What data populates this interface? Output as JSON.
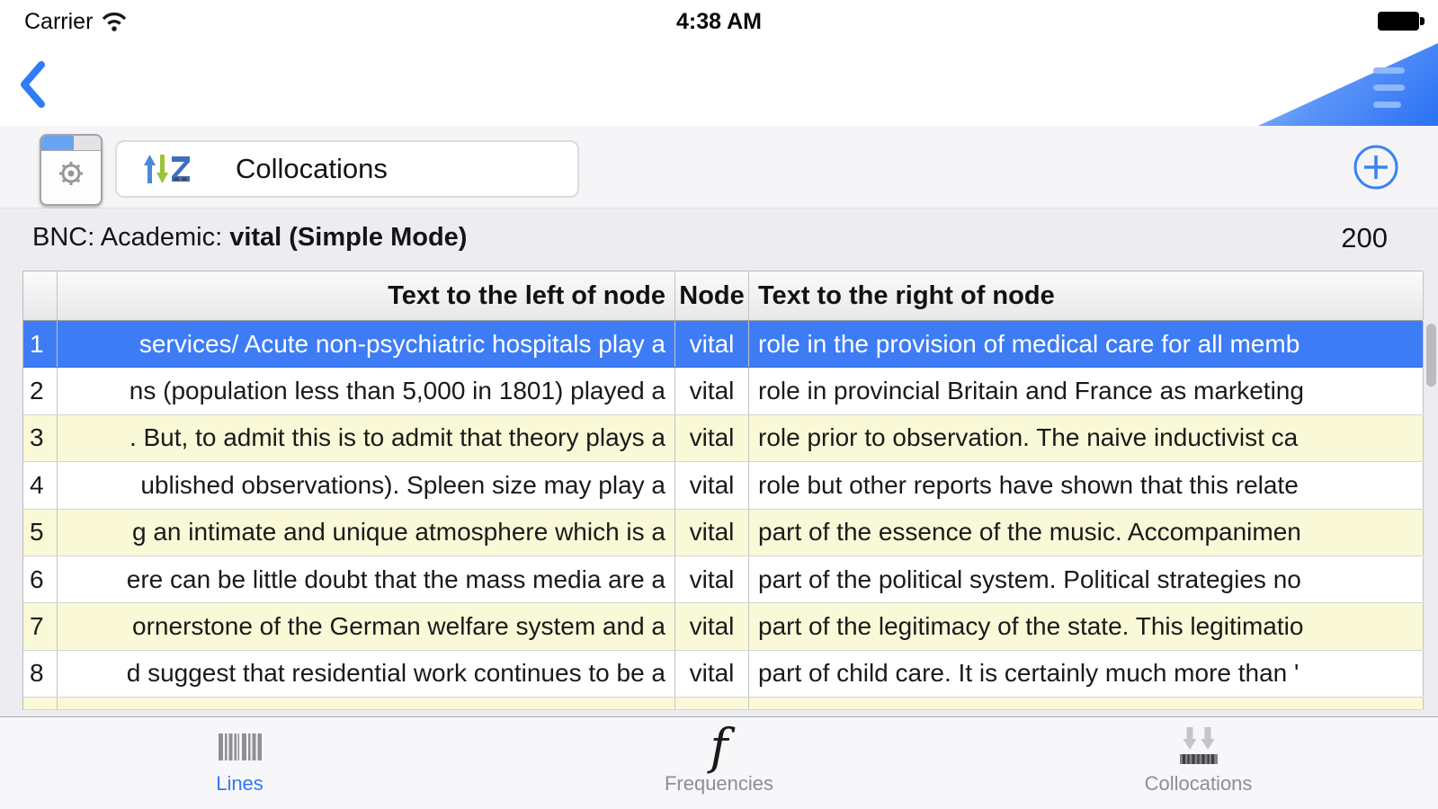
{
  "status_bar": {
    "carrier": "Carrier",
    "time": "4:38 AM",
    "wifi_icon": "wifi",
    "battery_icon": "battery-full"
  },
  "navbar": {
    "back_icon": "chevron-left",
    "menu_icon": "hamburger-menu"
  },
  "toolbar": {
    "settings_icon": "window-gear",
    "sort_icon": "sort-arrows",
    "query_label": "Collocations",
    "add_icon": "plus-circle"
  },
  "subheader": {
    "corpus_prefix": "BNC: Academic: ",
    "query": "vital (Simple Mode)",
    "hit_count": "200"
  },
  "table": {
    "headers": {
      "index": "",
      "left": "Text to the left of node",
      "node": "Node",
      "right": "Text to the right of node"
    },
    "rows": [
      {
        "n": "1",
        "left": "services/ Acute non-psychiatric hospitals play a",
        "node": "vital",
        "right": "role in the provision of medical care for all memb",
        "selected": true
      },
      {
        "n": "2",
        "left": "ns (population less than 5,000 in 1801) played a",
        "node": "vital",
        "right": "role in provincial Britain and France as marketing",
        "selected": false
      },
      {
        "n": "3",
        "left": ". But, to admit this is to admit that theory plays a",
        "node": "vital",
        "right": "role prior to observation. The naive inductivist ca",
        "selected": false
      },
      {
        "n": "4",
        "left": "ublished observations). Spleen size may play a",
        "node": "vital",
        "right": "role but other reports have shown that this relate",
        "selected": false
      },
      {
        "n": "5",
        "left": "g an intimate and unique atmosphere which is a",
        "node": "vital",
        "right": "part of the essence of the music. Accompanimen",
        "selected": false
      },
      {
        "n": "6",
        "left": "ere can be little doubt that the mass media are a",
        "node": "vital",
        "right": "part of the political system. Political strategies no",
        "selected": false
      },
      {
        "n": "7",
        "left": "ornerstone of the German welfare system and a",
        "node": "vital",
        "right": "part of the legitimacy of the state. This legitimatio",
        "selected": false
      },
      {
        "n": "8",
        "left": "d suggest that residential work continues to be a",
        "node": "vital",
        "right": "part of child care. It is certainly much more than '",
        "selected": false
      }
    ]
  },
  "tabbar": {
    "tabs": [
      {
        "label": "Lines",
        "icon": "barcode-lines-icon",
        "active": true
      },
      {
        "label": "Frequencies",
        "icon": "italic-f-icon",
        "icon_glyph": "f",
        "active": false
      },
      {
        "label": "Collocations",
        "icon": "collocation-arrows-icon",
        "active": false
      }
    ]
  },
  "colors": {
    "accent_blue": "#2e7cf6",
    "selected_row_blue": "#3d7cf5",
    "row_alt_yellow": "#f9f9d8",
    "tab_inactive_gray": "#8e8e93",
    "corner_gradient_blue": "#2a70f4"
  }
}
